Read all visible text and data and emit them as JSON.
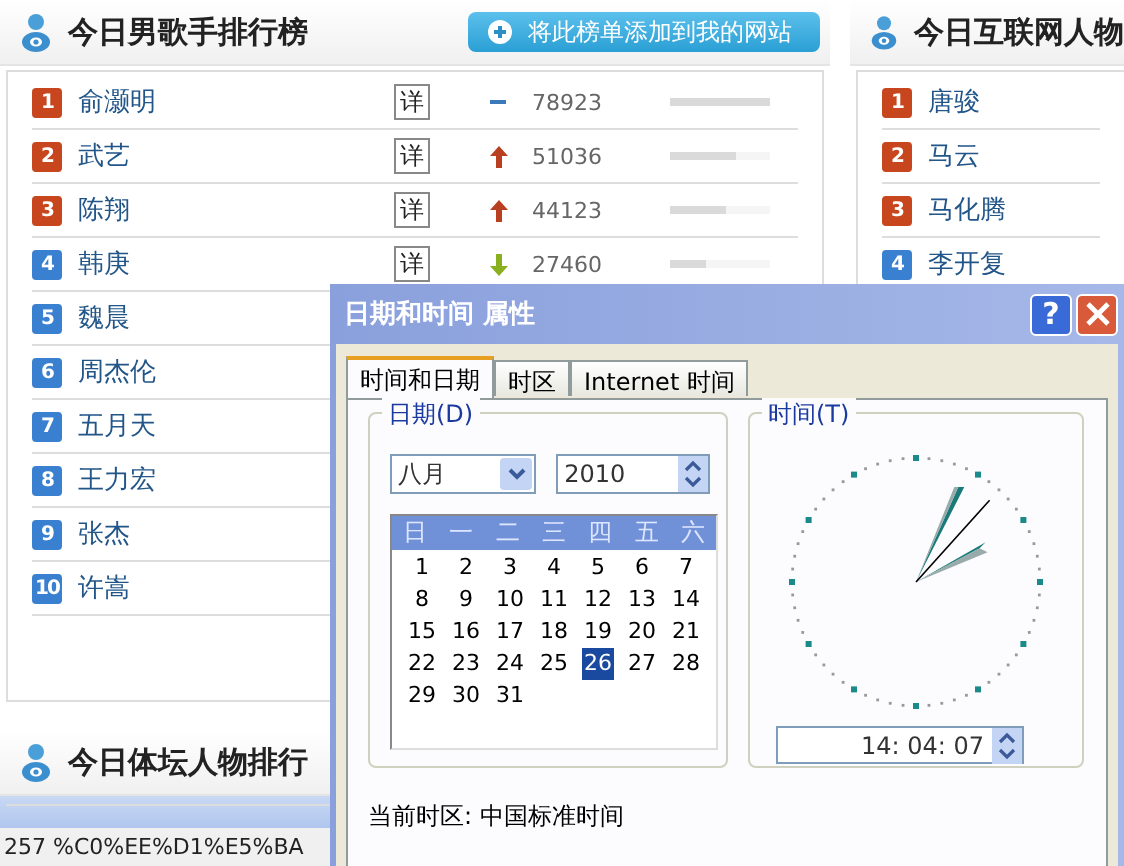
{
  "left_panel": {
    "title": "今日男歌手排行榜",
    "add_button": "将此榜单添加到我的网站",
    "rows": [
      {
        "rank": "1",
        "color": "#c8461e",
        "name": "俞灏明",
        "detail": "详",
        "trend": {
          "kind": "same"
        },
        "count": "78923",
        "level": 1
      },
      {
        "rank": "2",
        "color": "#c8461e",
        "name": "武艺",
        "detail": "详",
        "trend": {
          "kind": "up"
        },
        "count": "51036",
        "level": 0.65
      },
      {
        "rank": "3",
        "color": "#c8461e",
        "name": "陈翔",
        "detail": "详",
        "trend": {
          "kind": "up"
        },
        "count": "44123",
        "level": 0.56
      },
      {
        "rank": "4",
        "color": "#3a80d0",
        "name": "韩庚",
        "detail": "详",
        "trend": {
          "kind": "down"
        },
        "count": "27460",
        "level": 0.35
      },
      {
        "rank": "5",
        "color": "#3a80d0",
        "name": "魏晨"
      },
      {
        "rank": "6",
        "color": "#3a80d0",
        "name": "周杰伦"
      },
      {
        "rank": "7",
        "color": "#3a80d0",
        "name": "五月天"
      },
      {
        "rank": "8",
        "color": "#3a80d0",
        "name": "王力宏"
      },
      {
        "rank": "9",
        "color": "#3a80d0",
        "name": "张杰"
      },
      {
        "rank": "10",
        "color": "#3a80d0",
        "name": "许嵩"
      }
    ]
  },
  "sports_panel": {
    "title": "今日体坛人物排行"
  },
  "right_panel": {
    "title": "今日互联网人物",
    "rows": [
      {
        "rank": "1",
        "color": "#c8461e",
        "name": "唐骏"
      },
      {
        "rank": "2",
        "color": "#c8461e",
        "name": "马云"
      },
      {
        "rank": "3",
        "color": "#c8461e",
        "name": "马化腾"
      },
      {
        "rank": "4",
        "color": "#3a80d0",
        "name": "李开复"
      }
    ]
  },
  "status_bar": {
    "text": "257 %C0%EE%D1%E5%BA"
  },
  "dialog": {
    "title": "日期和时间 属性",
    "help": "?",
    "tabs": [
      {
        "label": "时间和日期",
        "selected": true
      },
      {
        "label": "时区",
        "selected": false
      },
      {
        "label": "Internet 时间",
        "selected": false
      }
    ],
    "date_group": {
      "label": "日期(D)",
      "month": "八月",
      "year": "2010",
      "weekdays": [
        "日",
        "一",
        "二",
        "三",
        "四",
        "五",
        "六"
      ],
      "days": [
        {
          "d": "1",
          "selected": false
        },
        {
          "d": "2",
          "selected": false
        },
        {
          "d": "3",
          "selected": false
        },
        {
          "d": "4",
          "selected": false
        },
        {
          "d": "5",
          "selected": false
        },
        {
          "d": "6",
          "selected": false
        },
        {
          "d": "7",
          "selected": false
        },
        {
          "d": "8",
          "selected": false
        },
        {
          "d": "9",
          "selected": false
        },
        {
          "d": "10",
          "selected": false
        },
        {
          "d": "11",
          "selected": false
        },
        {
          "d": "12",
          "selected": false
        },
        {
          "d": "13",
          "selected": false
        },
        {
          "d": "14",
          "selected": false
        },
        {
          "d": "15",
          "selected": false
        },
        {
          "d": "16",
          "selected": false
        },
        {
          "d": "17",
          "selected": false
        },
        {
          "d": "18",
          "selected": false
        },
        {
          "d": "19",
          "selected": false
        },
        {
          "d": "20",
          "selected": false
        },
        {
          "d": "21",
          "selected": false
        },
        {
          "d": "22",
          "selected": false
        },
        {
          "d": "23",
          "selected": false
        },
        {
          "d": "24",
          "selected": false
        },
        {
          "d": "25",
          "selected": false
        },
        {
          "d": "26",
          "selected": true
        },
        {
          "d": "27",
          "selected": false
        },
        {
          "d": "28",
          "selected": false
        },
        {
          "d": "29",
          "selected": false
        },
        {
          "d": "30",
          "selected": false
        },
        {
          "d": "31",
          "selected": false
        }
      ]
    },
    "time_group": {
      "label": "时间(T)",
      "time": "14: 04: 07"
    },
    "timezone": "当前时区: 中国标准时间"
  }
}
